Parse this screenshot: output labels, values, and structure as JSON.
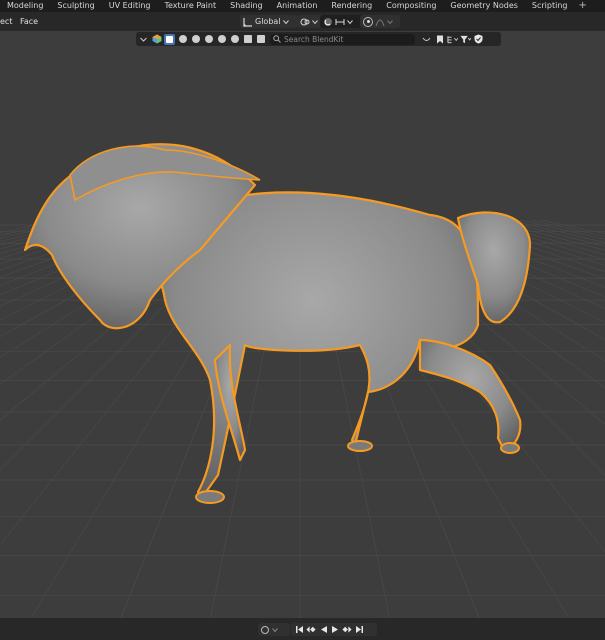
{
  "workspace_tabs": [
    "Modeling",
    "Sculpting",
    "UV Editing",
    "Texture Paint",
    "Shading",
    "Animation",
    "Rendering",
    "Compositing",
    "Geometry Nodes",
    "Scripting"
  ],
  "workspace_add": "+",
  "header": {
    "select_menu": "ect",
    "face_menu": "Face",
    "orientation": "Global",
    "orientation_icon": "transform-orientation-icon",
    "pivot_icon": "pivot-point-icon",
    "snap_icon": "snap-magnet-icon",
    "proportional_icon": "proportional-edit-icon"
  },
  "extension_toolbar": {
    "search_placeholder": "Search BlendKit",
    "asset_icons": [
      "blendkit-logo-icon",
      "model-icon",
      "material-icon",
      "scene-icon",
      "hdr-icon",
      "brush-icon",
      "printable-icon",
      "nodegroup-icon",
      "addon-icon"
    ],
    "right_icons": [
      "asset-bar-toggle-icon",
      "bookmark-icon",
      "category-icon",
      "filter-icon",
      "shield-icon"
    ],
    "accent": "#4772b3"
  },
  "viewport": {
    "object": "horse sculpt",
    "selection_color": "#f59a23",
    "grid_color": "#4a4a4a"
  },
  "playback": {
    "buttons": [
      "jump-start-icon",
      "prev-keyframe-icon",
      "play-reverse-icon",
      "play-icon",
      "next-keyframe-icon",
      "jump-end-icon"
    ],
    "keying_icon": "auto-keying-icon"
  }
}
